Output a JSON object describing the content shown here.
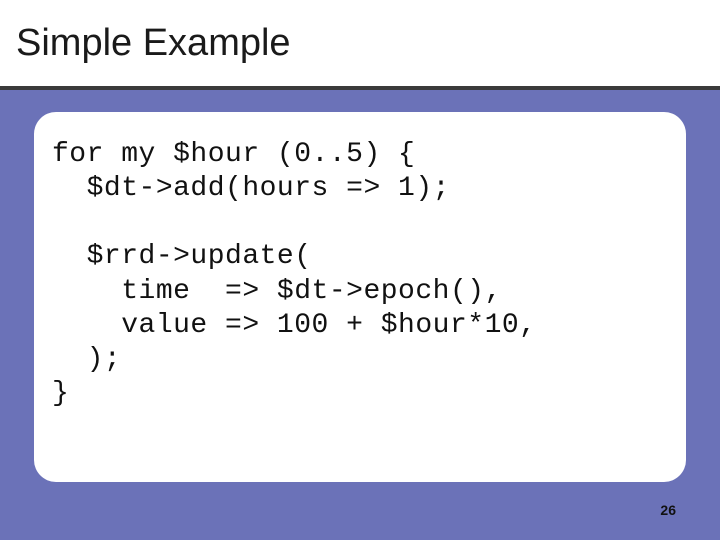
{
  "title": "Simple Example",
  "page_number": "26",
  "code": {
    "l1": "for my $hour (0..5) {",
    "l2": "  $dt->add(hours => 1);",
    "l3": "",
    "l4": "  $rrd->update(",
    "l5": "    time  => $dt->epoch(),",
    "l6": "    value => 100 + $hour*10,",
    "l7": "  );",
    "l8": "}"
  }
}
